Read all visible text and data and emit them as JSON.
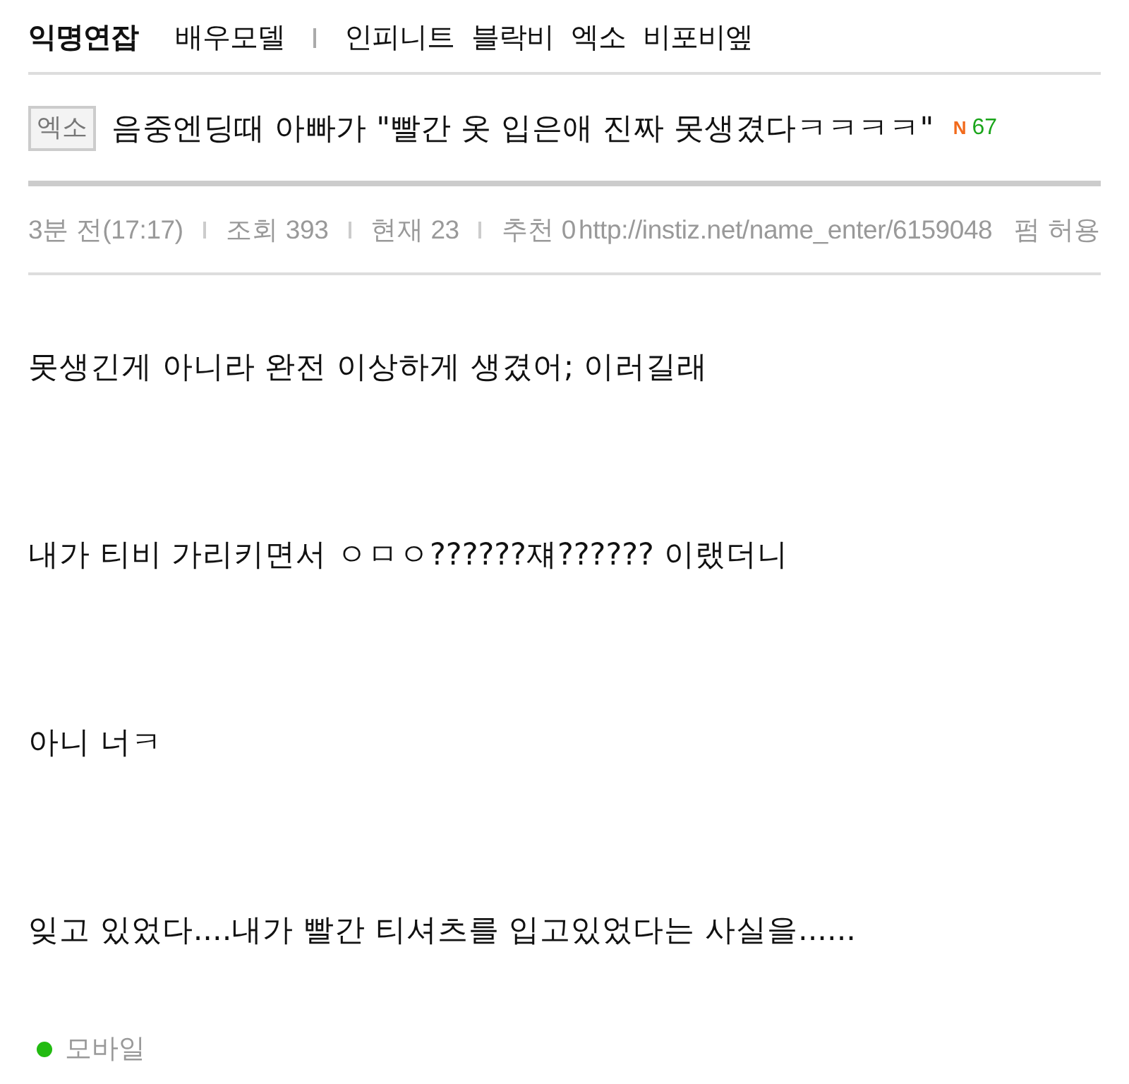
{
  "nav": {
    "board": "익명연잡",
    "category": "배우모델",
    "tags": [
      "인피니트",
      "블락비",
      "엑소",
      "비포비엪"
    ]
  },
  "post": {
    "tag": "엑소",
    "title": "음중엔딩때 아빠가 \"빨간 옷 입은애 진짜 못생겼다ㅋㅋㅋㅋ\"",
    "new_badge": "N",
    "comment_count": "67"
  },
  "meta": {
    "items": [
      "3분 전(17:17)",
      "조회 393",
      "현재 23",
      "추천 0"
    ],
    "url": "http://instiz.net/name_enter/6159048",
    "permission": "펌 허용"
  },
  "body": {
    "paragraphs": [
      "못생긴게 아니라 완전 이상하게 생겼어; 이러길래",
      "내가 티비 가리키면서 ㅇㅁㅇ??????쟤?????? 이랬더니",
      "아니 너ㅋ",
      "잊고 있었다....내가 빨간 티셔츠를 입고있었다는 사실을......"
    ]
  },
  "footer": {
    "device": "모바일"
  }
}
